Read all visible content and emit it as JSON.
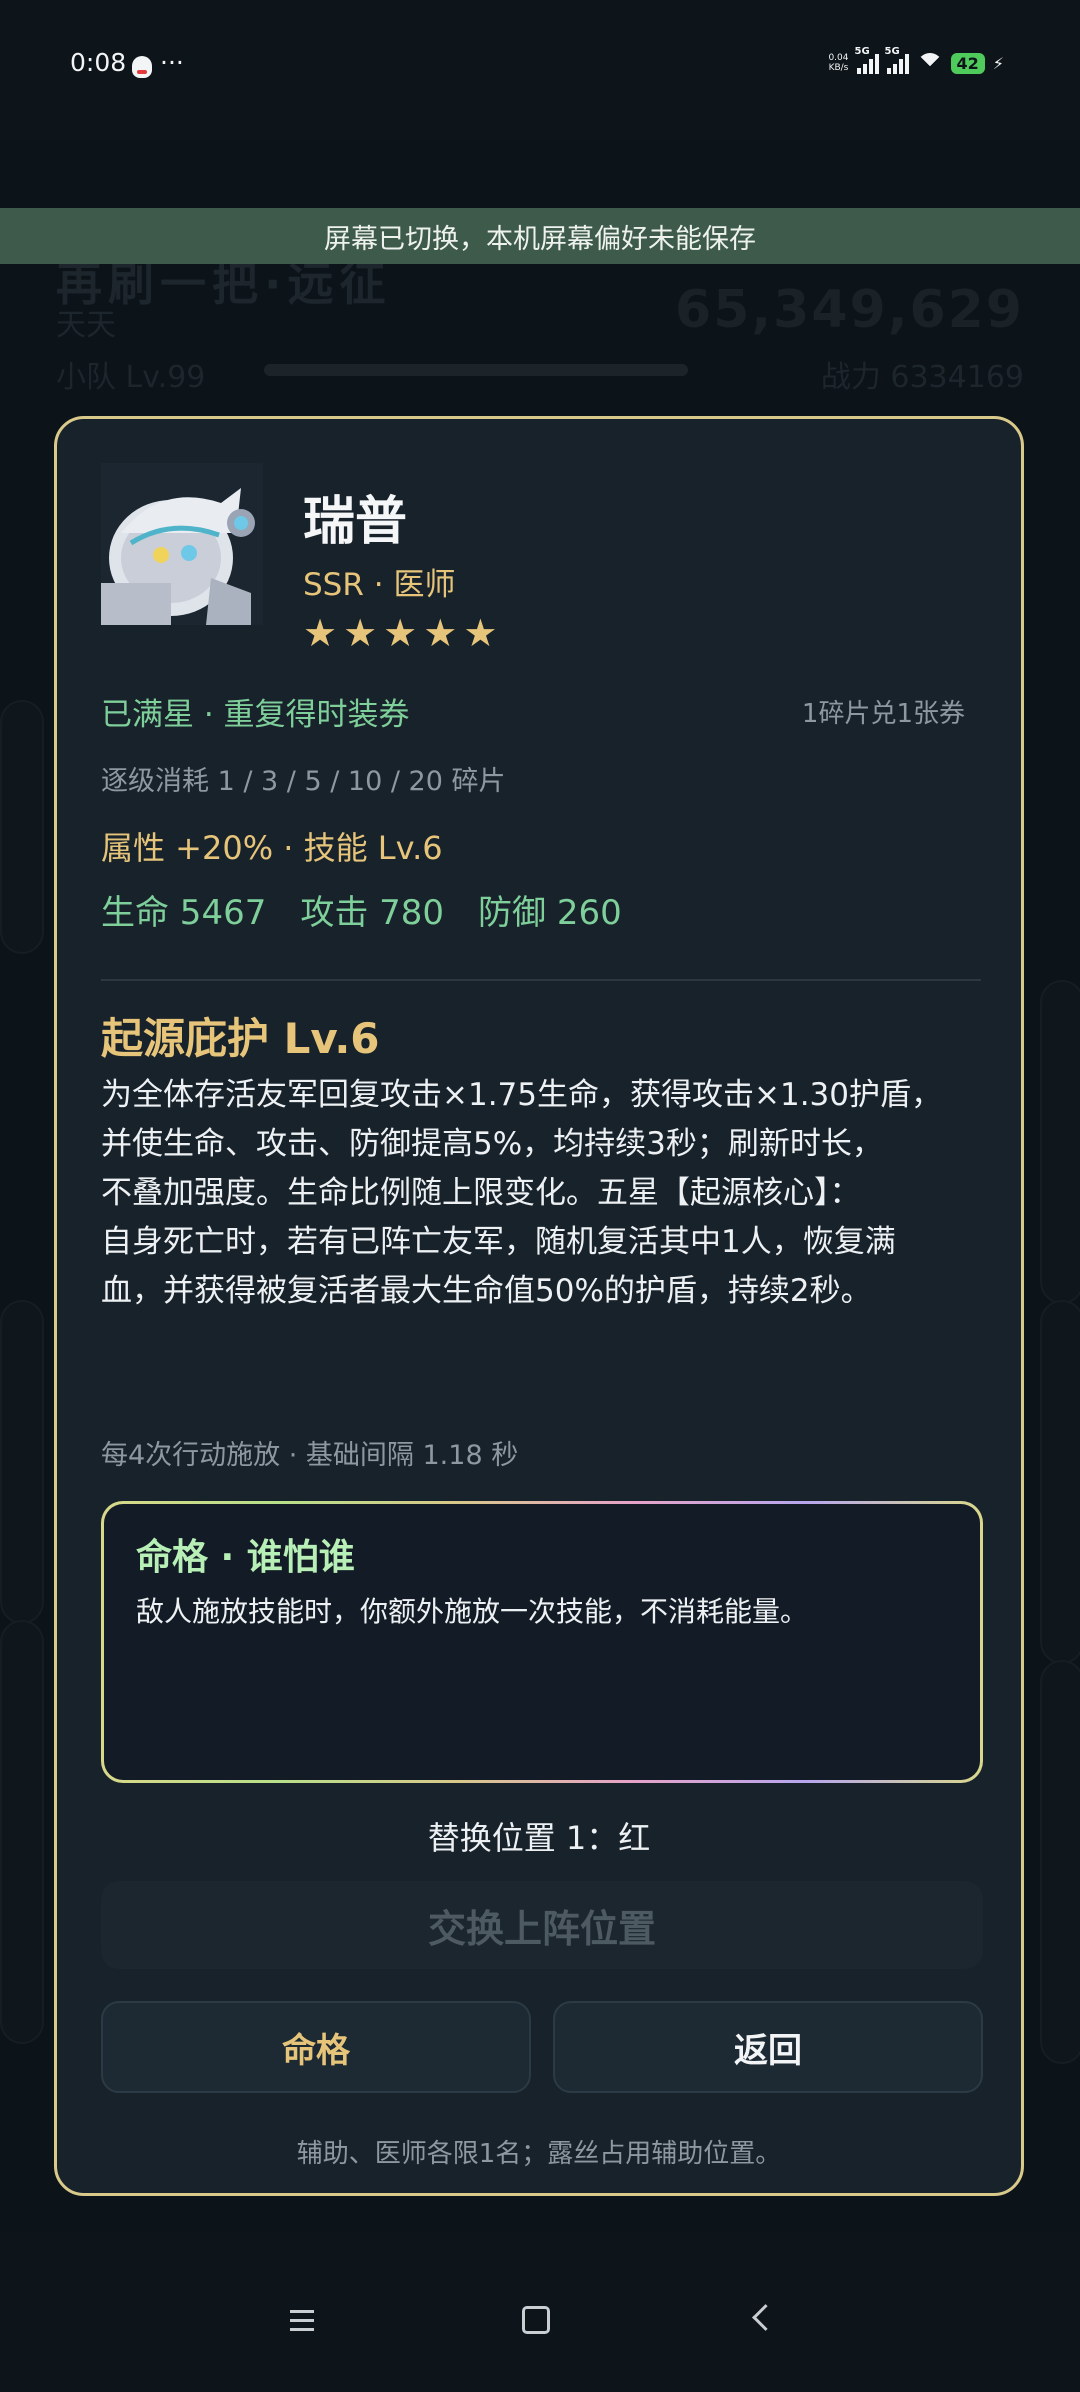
{
  "status_bar": {
    "time": "0:08",
    "net_speed": "0.04\nKB/s",
    "signal1_tag": "5G",
    "signal2_tag": "5G",
    "battery": "42"
  },
  "toast": "屏幕已切换，本机屏幕偏好未能保存",
  "background": {
    "title": "再刷一把·远征",
    "player_name": "天天",
    "team_level": "小队 Lv.99",
    "score": "65,349,629",
    "power": "战力 6334169"
  },
  "hero": {
    "name": "瑞普",
    "meta": "SSR · 医师",
    "stars": [
      "★",
      "★",
      "★",
      "★",
      "★"
    ],
    "max_star_note": "已满星 · 重复得时装券",
    "exchange_note": "1碎片兑1张券",
    "cost_note": "逐级消耗 1 / 3 / 5 / 10 / 20 碎片",
    "attr_line": "属性 +20% · 技能 Lv.6",
    "stats": {
      "hp": "生命 5467",
      "atk": "攻击 780",
      "def": "防御 260"
    }
  },
  "skill": {
    "title": "起源庇护 Lv.6",
    "description": "为全体存活友军回复攻击×1.75生命，获得攻击×1.30护盾，\n并使生命、攻击、防御提高5%，均持续3秒；刷新时长，\n不叠加强度。生命比例随上限变化。五星【起源核心】：\n自身死亡时，若有已阵亡友军，随机复活其中1人，恢复满\n血，并获得被复活者最大生命值50%的护盾，持续2秒。",
    "cast_info": "每4次行动施放 · 基础间隔 1.18 秒"
  },
  "fate": {
    "title": "命格 · 谁怕谁",
    "description": "敌人施放技能时，你额外施放一次技能，不消耗能量。"
  },
  "swap_position": "替换位置 1：红",
  "buttons": {
    "swap": "交换上阵位置",
    "fate": "命格",
    "back": "返回"
  },
  "footer_note": "辅助、医师各限1名；露丝占用辅助位置。",
  "colors": {
    "gold": "#e6c47a",
    "green": "#7fcf9a",
    "modal_border": "#d9c98a",
    "toast_bg": "#3e5a4a"
  },
  "icons": {
    "nav_menu": "menu-icon",
    "nav_home": "home-icon",
    "nav_back": "back-icon"
  }
}
